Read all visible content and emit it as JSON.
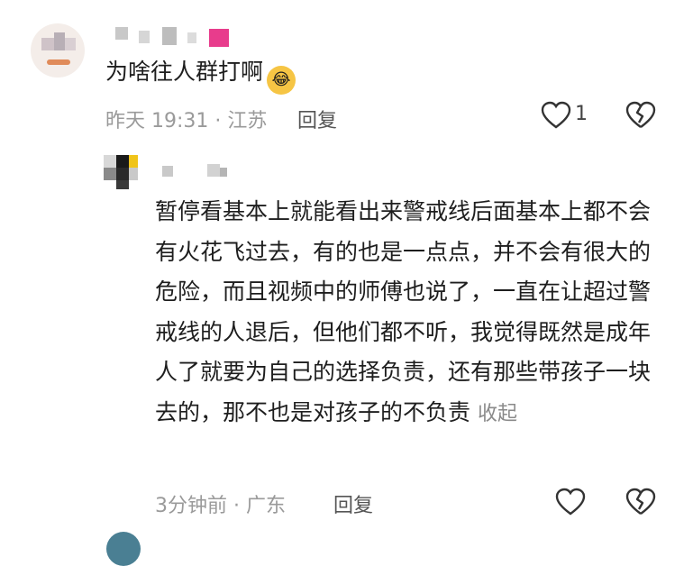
{
  "comment": {
    "text": "为啥往人群打啊",
    "emoji": "😂",
    "time": "昨天 19:31",
    "location": "· 江苏",
    "reply_label": "回复",
    "like_count": "1"
  },
  "reply": {
    "text": "暂停看基本上就能看出来警戒线后面基本上都不会有火花飞过去，有的也是一点点，并不会有很大的危险，而且视频中的师傅也说了，一直在让超过警戒线的人退后，但他们都不听，我觉得既然是成年人了就要为自己的选择负责，还有那些带孩子一块去的，那不也是对孩子的不负责",
    "collapse_label": "收起",
    "time": "3分钟前",
    "location": "· 广东",
    "reply_label": "回复"
  },
  "icons": {
    "like": "heart-outline-icon",
    "dislike": "broken-heart-icon"
  },
  "colors": {
    "meta_text": "#9a9a9a",
    "icon_stroke": "#333333"
  }
}
